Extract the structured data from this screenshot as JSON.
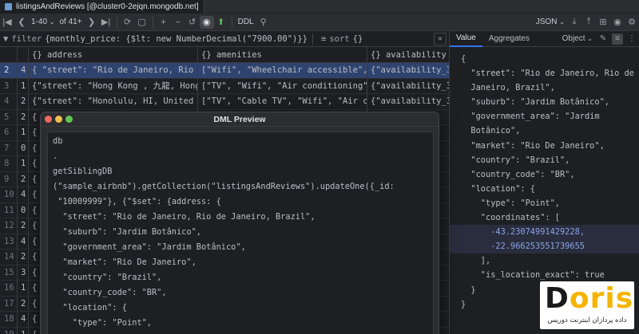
{
  "tab": {
    "title": "listingsAndReviews [@cluster0-2ejqn.mongodb.net]"
  },
  "toolbar": {
    "pager": "1-40",
    "of_total": "of 41+",
    "ddl_label": "DDL",
    "format_label": "JSON"
  },
  "filter": {
    "label": "filter",
    "query": "{monthly_price: {$lt: new NumberDecimal(\"7900.00\")}}",
    "sort_label": "sort",
    "sort_value": "{}"
  },
  "grid": {
    "columns": [
      "{} address",
      "{} amenities",
      "{} availability"
    ],
    "rows": [
      {
        "n": "2",
        "sub": "4",
        "address": "{   \"street\": \"Rio de Janeiro, Rio d",
        "amenities": "[\"Wifi\", \"Wheelchair accessible\", \"K",
        "availability": "{\"availability_30"
      },
      {
        "n": "3",
        "sub": "1",
        "address": "{\"street\": \"Hong Kong , 九龍, Hong Ko",
        "amenities": "[\"TV\", \"Wifi\", \"Air conditioning\", \"",
        "availability": "{\"availability_30"
      },
      {
        "n": "4",
        "sub": "2",
        "address": "{\"street\": \"Honolulu, HI, United Sta",
        "amenities": "[\"TV\", \"Cable TV\", \"Wifi\", \"Air cond",
        "availability": "{\"availability_30"
      },
      {
        "n": "5",
        "sub": "2",
        "address": "{",
        "amenities": "",
        "availability": ""
      },
      {
        "n": "6",
        "sub": "1",
        "address": "{",
        "amenities": "",
        "availability": ""
      },
      {
        "n": "7",
        "sub": "0",
        "address": "{",
        "amenities": "",
        "availability": ""
      },
      {
        "n": "8",
        "sub": "1",
        "address": "{",
        "amenities": "",
        "availability": ""
      },
      {
        "n": "9",
        "sub": "2",
        "address": "{",
        "amenities": "",
        "availability": ""
      },
      {
        "n": "10",
        "sub": "4",
        "address": "{",
        "amenities": "",
        "availability": ""
      },
      {
        "n": "11",
        "sub": "0",
        "address": "{",
        "amenities": "",
        "availability": ""
      },
      {
        "n": "12",
        "sub": "2",
        "address": "{",
        "amenities": "",
        "availability": ""
      },
      {
        "n": "13",
        "sub": "4",
        "address": "{",
        "amenities": "",
        "availability": ""
      },
      {
        "n": "14",
        "sub": "2",
        "address": "{",
        "amenities": "",
        "availability": ""
      },
      {
        "n": "15",
        "sub": "3",
        "address": "{",
        "amenities": "",
        "availability": ""
      },
      {
        "n": "16",
        "sub": "1",
        "address": "{",
        "amenities": "",
        "availability": ""
      },
      {
        "n": "17",
        "sub": "2",
        "address": "{",
        "amenities": "",
        "availability": ""
      },
      {
        "n": "18",
        "sub": "4",
        "address": "{",
        "amenities": "",
        "availability": ""
      },
      {
        "n": "19",
        "sub": "1",
        "address": "{",
        "amenities": "",
        "availability": ""
      }
    ]
  },
  "right_panel": {
    "tab_value": "Value",
    "tab_aggregates": "Aggregates",
    "object_select": "Object",
    "json_lines": [
      "{",
      "  \"street\": \"Rio de Janeiro, Rio de",
      "  Janeiro, Brazil\",",
      "  \"suburb\": \"Jardim Botânico\",",
      "  \"government_area\": \"Jardim",
      "  Botânico\",",
      "  \"market\": \"Rio De Janeiro\",",
      "  \"country\": \"Brazil\",",
      "  \"country_code\": \"BR\",",
      "  \"location\": {",
      "    \"type\": \"Point\",",
      "    \"coordinates\": [",
      "      -43.23074991429228,",
      "      -22.966253551739655",
      "    ],",
      "    \"is_location_exact\": true",
      "  }",
      "}"
    ]
  },
  "modal": {
    "title": "DML Preview",
    "lines": [
      "db",
      ".",
      "getSiblingDB",
      "(\"sample_airbnb\").getCollection(\"listingsAndReviews\").updateOne({_id:",
      " \"10009999\"}, {\"$set\": {address: {",
      "  \"street\": \"Rio de Janeiro, Rio de Janeiro, Brazil\",",
      "  \"suburb\": \"Jardim Botânico\",",
      "  \"government_area\": \"Jardim Botânico\",",
      "  \"market\": \"Rio De Janeiro\",",
      "  \"country\": \"Brazil\",",
      "  \"country_code\": \"BR\",",
      "  \"location\": {",
      "    \"type\": \"Point\",",
      "    \"coordinates\": ["
    ]
  },
  "logo": {
    "text_dark": "D",
    "text_accent": "oris",
    "subtitle": "داده پردازان اینترنت دوریس"
  }
}
